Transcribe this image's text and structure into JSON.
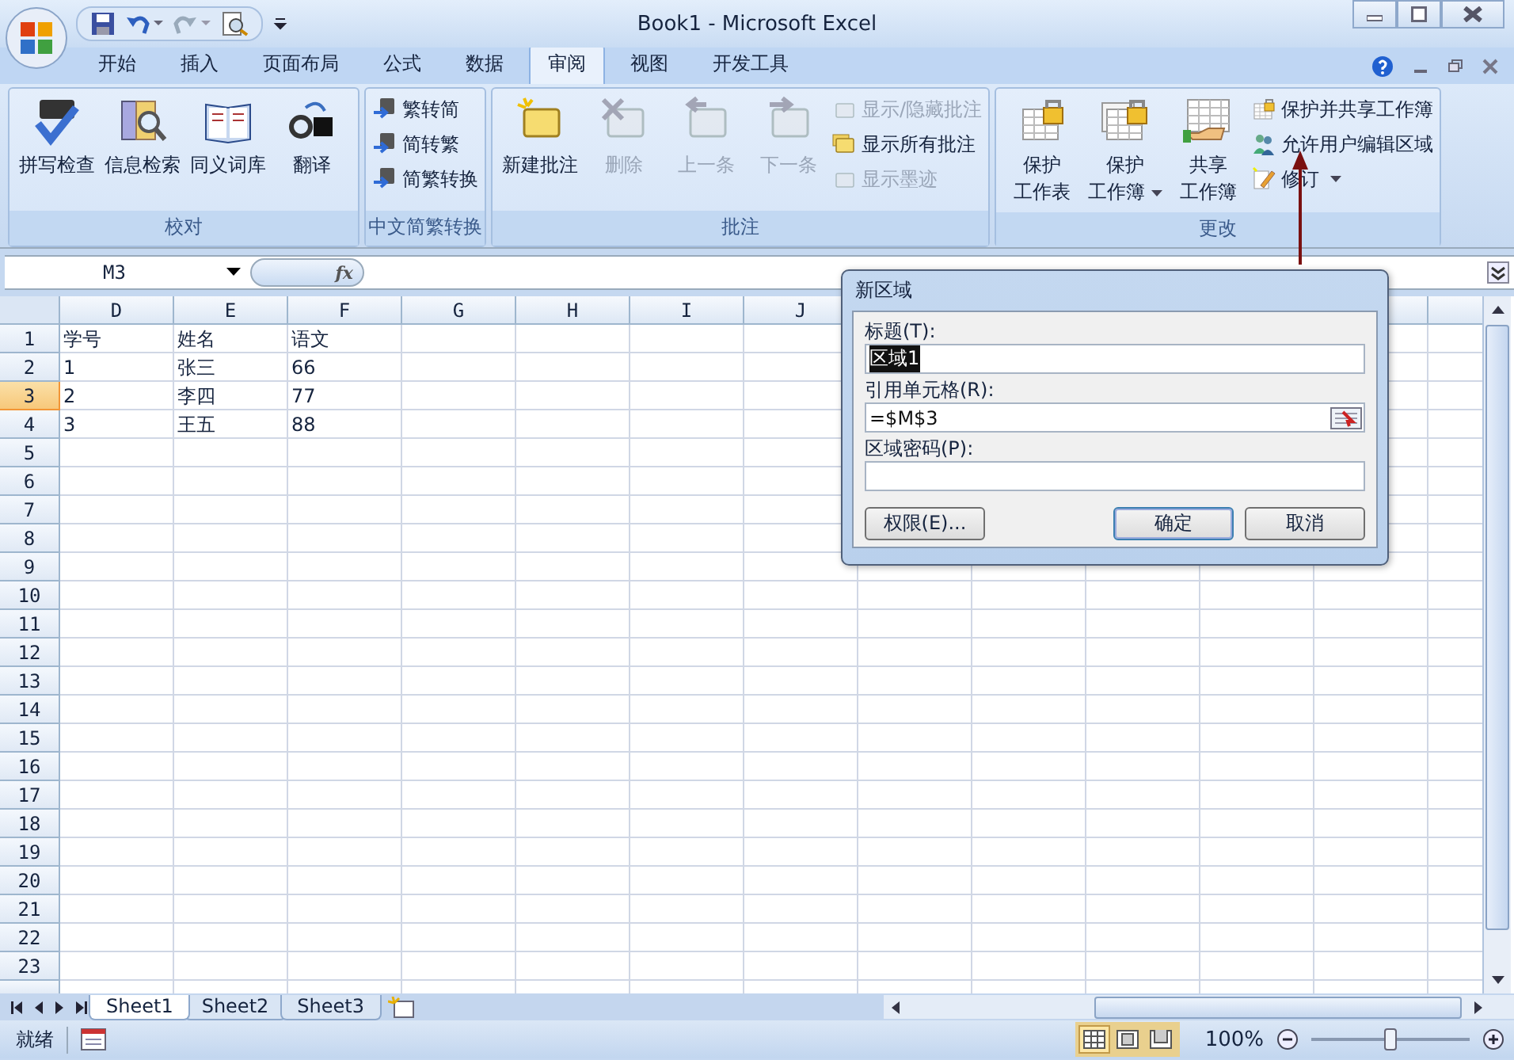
{
  "window": {
    "title": "Book1 - Microsoft Excel"
  },
  "tabs": [
    {
      "label": "开始",
      "selected": false
    },
    {
      "label": "插入",
      "selected": false
    },
    {
      "label": "页面布局",
      "selected": false
    },
    {
      "label": "公式",
      "selected": false
    },
    {
      "label": "数据",
      "selected": false
    },
    {
      "label": "审阅",
      "selected": true
    },
    {
      "label": "视图",
      "selected": false
    },
    {
      "label": "开发工具",
      "selected": false
    }
  ],
  "ribbon_groups": [
    {
      "title": "校对",
      "large_buttons": [
        {
          "kind": "spell",
          "lines": [
            "拼写检查"
          ],
          "disabled": false,
          "dropdown": false
        },
        {
          "kind": "research",
          "lines": [
            "信息检索"
          ],
          "disabled": false,
          "dropdown": false
        },
        {
          "kind": "thesaurus",
          "lines": [
            "同义词库"
          ],
          "disabled": false,
          "dropdown": false
        },
        {
          "kind": "translate",
          "lines": [
            "翻译"
          ],
          "disabled": false,
          "dropdown": false
        }
      ]
    },
    {
      "title": "中文简繁转换",
      "small_buttons": [
        {
          "kind": "convert",
          "label": "繁转简",
          "disabled": false,
          "dropdown": false
        },
        {
          "kind": "convert",
          "label": "简转繁",
          "disabled": false,
          "dropdown": false
        },
        {
          "kind": "convert",
          "label": "简繁转换",
          "disabled": false,
          "dropdown": false
        }
      ]
    },
    {
      "title": "批注",
      "large_buttons": [
        {
          "kind": "new-note",
          "lines": [
            "新建批注"
          ],
          "disabled": false,
          "dropdown": false
        },
        {
          "kind": "delete-note",
          "lines": [
            "删除"
          ],
          "disabled": true,
          "dropdown": false
        },
        {
          "kind": "prev-note",
          "lines": [
            "上一条"
          ],
          "disabled": true,
          "dropdown": false
        },
        {
          "kind": "next-note",
          "lines": [
            "下一条"
          ],
          "disabled": true,
          "dropdown": false
        }
      ],
      "small_buttons": [
        {
          "kind": "note",
          "label": "显示/隐藏批注",
          "disabled": true,
          "dropdown": false
        },
        {
          "kind": "notes",
          "label": "显示所有批注",
          "disabled": false,
          "dropdown": false
        },
        {
          "kind": "ink",
          "label": "显示墨迹",
          "disabled": true,
          "dropdown": false
        }
      ]
    },
    {
      "title": "更改",
      "large_buttons": [
        {
          "kind": "lock-sheet",
          "lines": [
            "保护",
            "工作表"
          ],
          "disabled": false,
          "dropdown": false
        },
        {
          "kind": "lock-book",
          "lines": [
            "保护",
            "工作簿"
          ],
          "disabled": false,
          "dropdown": true
        },
        {
          "kind": "share",
          "lines": [
            "共享",
            "工作簿"
          ],
          "disabled": false,
          "dropdown": false
        }
      ],
      "small_buttons": [
        {
          "kind": "lock-share",
          "label": "保护并共享工作簿",
          "disabled": false,
          "dropdown": false
        },
        {
          "kind": "users",
          "label": "允许用户编辑区域",
          "disabled": false,
          "dropdown": false
        },
        {
          "kind": "track",
          "label": "修订",
          "disabled": false,
          "dropdown": true
        }
      ]
    }
  ],
  "formula_bar": {
    "name_box": "M3",
    "function_label": "fx"
  },
  "columns": [
    {
      "label": "D"
    },
    {
      "label": "E"
    },
    {
      "label": "F"
    },
    {
      "label": "G"
    },
    {
      "label": "H"
    },
    {
      "label": "I"
    },
    {
      "label": "J"
    }
  ],
  "rows": [
    {
      "header": "1",
      "selected": false,
      "cells": [
        "学号",
        "姓名",
        "语文"
      ]
    },
    {
      "header": "2",
      "selected": false,
      "cells": [
        "1",
        "张三",
        "66"
      ]
    },
    {
      "header": "3",
      "selected": true,
      "cells": [
        "2",
        "李四",
        "77"
      ]
    },
    {
      "header": "4",
      "selected": false,
      "cells": [
        "3",
        "王五",
        "88"
      ]
    },
    {
      "header": "5",
      "selected": false
    },
    {
      "header": "6",
      "selected": false
    },
    {
      "header": "7",
      "selected": false
    },
    {
      "header": "8",
      "selected": false
    },
    {
      "header": "9",
      "selected": false
    },
    {
      "header": "10",
      "selected": false
    },
    {
      "header": "11",
      "selected": false
    },
    {
      "header": "12",
      "selected": false
    },
    {
      "header": "13",
      "selected": false
    },
    {
      "header": "14",
      "selected": false
    },
    {
      "header": "15",
      "selected": false
    },
    {
      "header": "16",
      "selected": false
    },
    {
      "header": "17",
      "selected": false
    },
    {
      "header": "18",
      "selected": false
    },
    {
      "header": "19",
      "selected": false
    },
    {
      "header": "20",
      "selected": false
    },
    {
      "header": "21",
      "selected": false
    },
    {
      "header": "22",
      "selected": false
    },
    {
      "header": "23",
      "selected": false
    }
  ],
  "dialog": {
    "title": "新区域",
    "fields": [
      {
        "label": "标题(T):",
        "value": "区域1",
        "text_selected": true,
        "picker": false
      },
      {
        "label": "引用单元格(R):",
        "value": "=$M$3",
        "text_selected": false,
        "picker": true
      },
      {
        "label": "区域密码(P):",
        "picker": false
      }
    ],
    "buttons": [
      {
        "label": "权限(E)...",
        "default": false
      },
      {
        "label": "确定",
        "default": true
      },
      {
        "label": "取消",
        "default": false
      }
    ]
  },
  "sheet_tabs": [
    {
      "label": "Sheet1",
      "selected": true
    },
    {
      "label": "Sheet2",
      "selected": false
    },
    {
      "label": "Sheet3",
      "selected": false
    }
  ],
  "status_bar": {
    "text": "就绪",
    "views": [
      {
        "kind": "normal",
        "selected": true
      },
      {
        "kind": "layout",
        "selected": false
      },
      {
        "kind": "break",
        "selected": false
      }
    ],
    "zoom": "100%",
    "zoom_slider": {
      "level": 0.5
    }
  }
}
